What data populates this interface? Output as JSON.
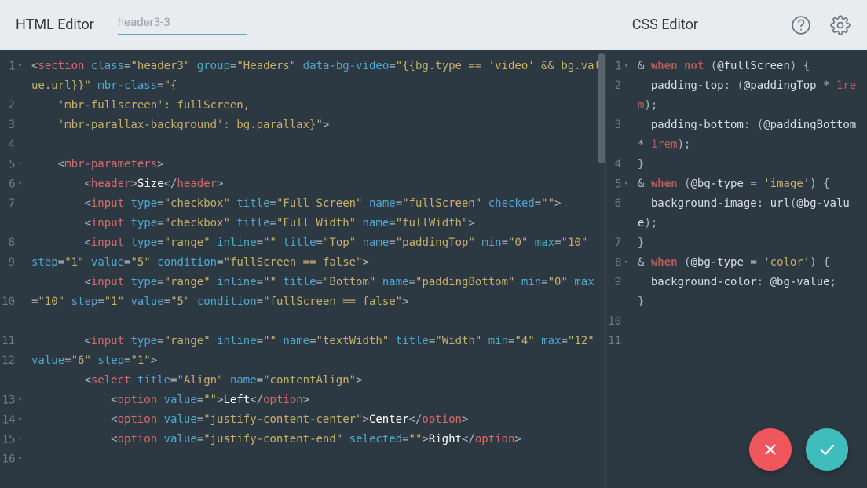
{
  "header": {
    "html_editor_title": "HTML Editor",
    "filename": "header3-3",
    "css_editor_title": "CSS Editor"
  },
  "icons": {
    "help": "help-icon",
    "settings": "gear-icon",
    "cancel": "close-icon",
    "confirm": "check-icon"
  },
  "html_code": {
    "lines": [
      {
        "num": "1",
        "fold": true
      },
      {
        "num": "2",
        "fold": false
      },
      {
        "num": "3",
        "fold": false
      },
      {
        "num": "4",
        "fold": false
      },
      {
        "num": "5",
        "fold": true
      },
      {
        "num": "6",
        "fold": true
      },
      {
        "num": "7",
        "fold": false
      },
      {
        "num": "8",
        "fold": false
      },
      {
        "num": "9",
        "fold": false
      },
      {
        "num": "10",
        "fold": false
      },
      {
        "num": "11",
        "fold": false
      },
      {
        "num": "12",
        "fold": false
      },
      {
        "num": "13",
        "fold": true
      },
      {
        "num": "14",
        "fold": true
      },
      {
        "num": "15",
        "fold": true
      },
      {
        "num": "16",
        "fold": true
      }
    ],
    "l1_open": "<",
    "l1_tag": "section",
    "l1_a1": "class",
    "l1_v1": "\"header3\"",
    "l1_a2": "group",
    "l1_v2": "\"Headers\"",
    "l1_a3": "data-bg-video",
    "l1_v3a": "\"{{bg.type == 'video' &amp;&amp; bg.value.url}}\"",
    "l1_a4": "mbr-class",
    "l1_v4": "\"{",
    "l2_text": "'mbr-fullscreen': fullScreen,",
    "l3_text": "'mbr-parallax-background': bg.parallax}\"",
    "l3_close": ">",
    "l5_tag": "mbr-parameters",
    "l6_tag": "header",
    "l6_text": "Size",
    "l7_tag": "input",
    "l7_a1": "type",
    "l7_v1": "\"checkbox\"",
    "l7_a2": "title",
    "l7_v2": "\"Full Screen\"",
    "l7_a3": "name",
    "l7_v3": "\"fullScreen\"",
    "l7_a4": "checked",
    "l7_v4": "\"\"",
    "l8_a2v": "\"Full Width\"",
    "l8_a3v": "\"fullWidth\"",
    "l9_typev": "\"range\"",
    "l9_inline": "inline",
    "l9_inlinev": "\"\"",
    "l9_titlev": "\"Top\"",
    "l9_namev": "\"paddingTop\"",
    "l9_min": "min",
    "l9_minv": "\"0\"",
    "l9_max": "max",
    "l9_maxv": "\"10\"",
    "l9_step": "step",
    "l9_stepv": "\"1\"",
    "l9_value": "value",
    "l9_valuev": "\"5\"",
    "l9_cond": "condition",
    "l9_condv": "\"fullScreen == false\"",
    "l10_titlev": "\"Bottom\"",
    "l10_namev": "\"paddingBottom\"",
    "l12_namev": "\"textWidth\"",
    "l12_titlev": "\"Width\"",
    "l12_minv": "\"4\"",
    "l12_maxv": "\"12\"",
    "l12_valuev": "\"6\"",
    "l12_stepv": "\"1\"",
    "l13_tag": "select",
    "l13_titlev": "\"Align\"",
    "l13_namev": "\"contentAlign\"",
    "l14_tag": "option",
    "l14_valuev": "\"\"",
    "l14_text": "Left",
    "l15_valuev": "\"justify-content-center\"",
    "l15_text": "Center",
    "l16_valuev": "\"justify-content-end\"",
    "l16_sel": "selected",
    "l16_selv": "\"\"",
    "l16_text": "Right"
  },
  "css_code": {
    "lines": [
      {
        "num": "1",
        "fold": true
      },
      {
        "num": "2",
        "fold": false
      },
      {
        "num": "3",
        "fold": false
      },
      {
        "num": "4",
        "fold": false
      },
      {
        "num": "5",
        "fold": true
      },
      {
        "num": "6",
        "fold": false
      },
      {
        "num": "7",
        "fold": false
      },
      {
        "num": "8",
        "fold": true
      },
      {
        "num": "9",
        "fold": false
      },
      {
        "num": "10",
        "fold": false
      },
      {
        "num": "11",
        "fold": false
      }
    ],
    "amp": "&",
    "when": "when",
    "not": "not",
    "fullscreen_var": "@fullScreen",
    "brace_open": "{",
    "brace_close": "}",
    "padding_top": "padding-top",
    "padding_bottom": "padding-bottom",
    "paddingTop_var": "@paddingTop",
    "paddingBottom_var": "@paddingBottom",
    "times": "*",
    "onerem": "1rem",
    "bgtype_var": "@bg-type",
    "eq": "=",
    "image_str": "'image'",
    "color_str": "'color'",
    "bg_image_prop": "background-image",
    "bg_color_prop": "background-color",
    "url_fn": "url",
    "bgvalue_var": "@bg-value"
  },
  "fab": {
    "cancel_color": "#f0575c",
    "confirm_color": "#3fbdbd"
  }
}
